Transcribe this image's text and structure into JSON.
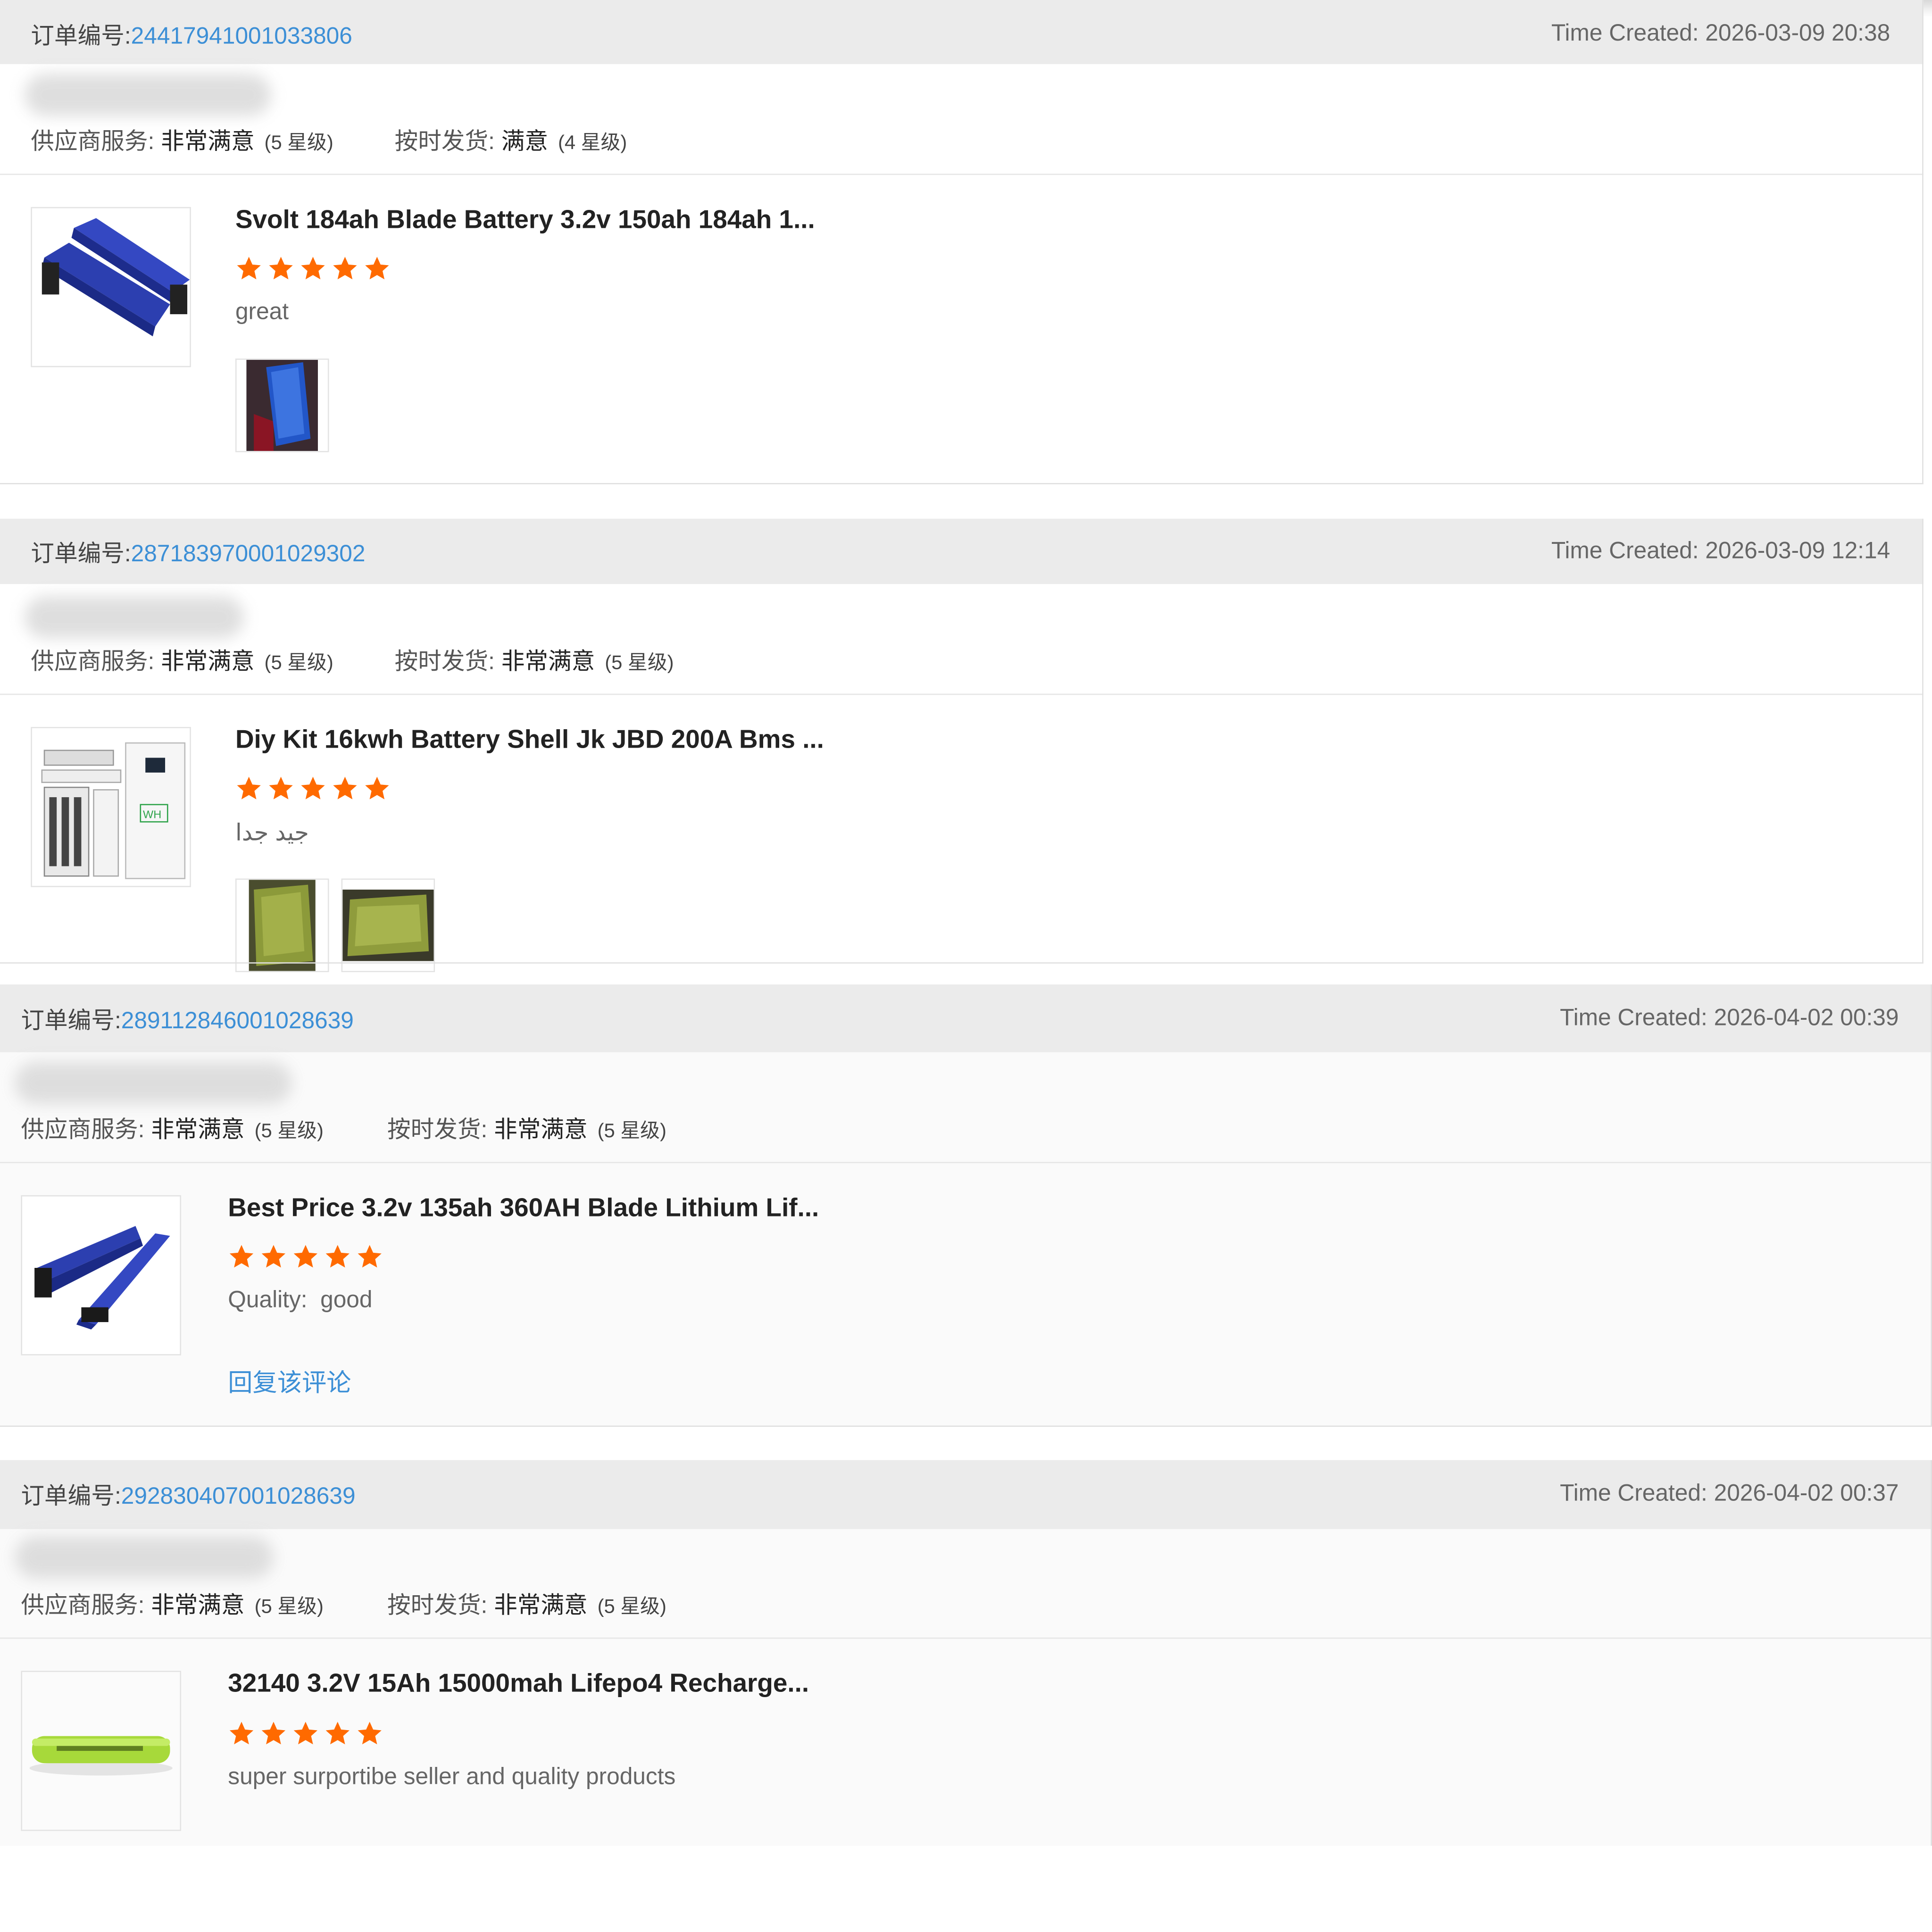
{
  "labels": {
    "order_number": "订单编号:",
    "time_created": "Time Created: ",
    "supplier_service": "供应商服务: ",
    "on_time_shipping": "按时发货: "
  },
  "reviews": [
    {
      "order_id": "24417941001033806",
      "time_created": "2026-03-09 20:38",
      "supplier_service": {
        "value": "非常满意",
        "level": "(5 星级)"
      },
      "on_time_shipping": {
        "value": "满意",
        "level": "(4 星级)"
      },
      "product_title": "Svolt 184ah Blade Battery 3.2v 150ah 184ah 1...",
      "rating": 5,
      "comment": "great",
      "photo_count": 1
    },
    {
      "order_id": "287183970001029302",
      "time_created": "2026-03-09 12:14",
      "supplier_service": {
        "value": "非常满意",
        "level": "(5 星级)"
      },
      "on_time_shipping": {
        "value": "非常满意",
        "level": "(5 星级)"
      },
      "product_title": "Diy Kit 16kwh Battery Shell Jk JBD 200A Bms ...",
      "rating": 5,
      "comment": "جيد جدا",
      "photo_count": 2
    },
    {
      "order_id": "289112846001028639",
      "time_created": "2026-04-02 00:39",
      "supplier_service": {
        "value": "非常满意",
        "level": "(5 星级)"
      },
      "on_time_shipping": {
        "value": "非常满意",
        "level": "(5 星级)"
      },
      "product_title": "Best Price 3.2v 135ah 360AH Blade Lithium Lif...",
      "rating": 5,
      "comment": "Quality:  good",
      "reply_link": "回复该评论"
    },
    {
      "order_id": "292830407001028639",
      "time_created": "2026-04-02 00:37",
      "supplier_service": {
        "value": "非常满意",
        "level": "(5 星级)"
      },
      "on_time_shipping": {
        "value": "非常满意",
        "level": "(5 星级)"
      },
      "product_title": "32140 3.2V 15Ah 15000mah Lifepo4 Recharge...",
      "rating": 5,
      "comment": "super surportibe seller and quality products"
    }
  ],
  "colors": {
    "link": "#3c8fd6",
    "star": "#ff6a00",
    "header_bg": "#ebebeb"
  },
  "icons": {
    "star": "star-icon"
  }
}
